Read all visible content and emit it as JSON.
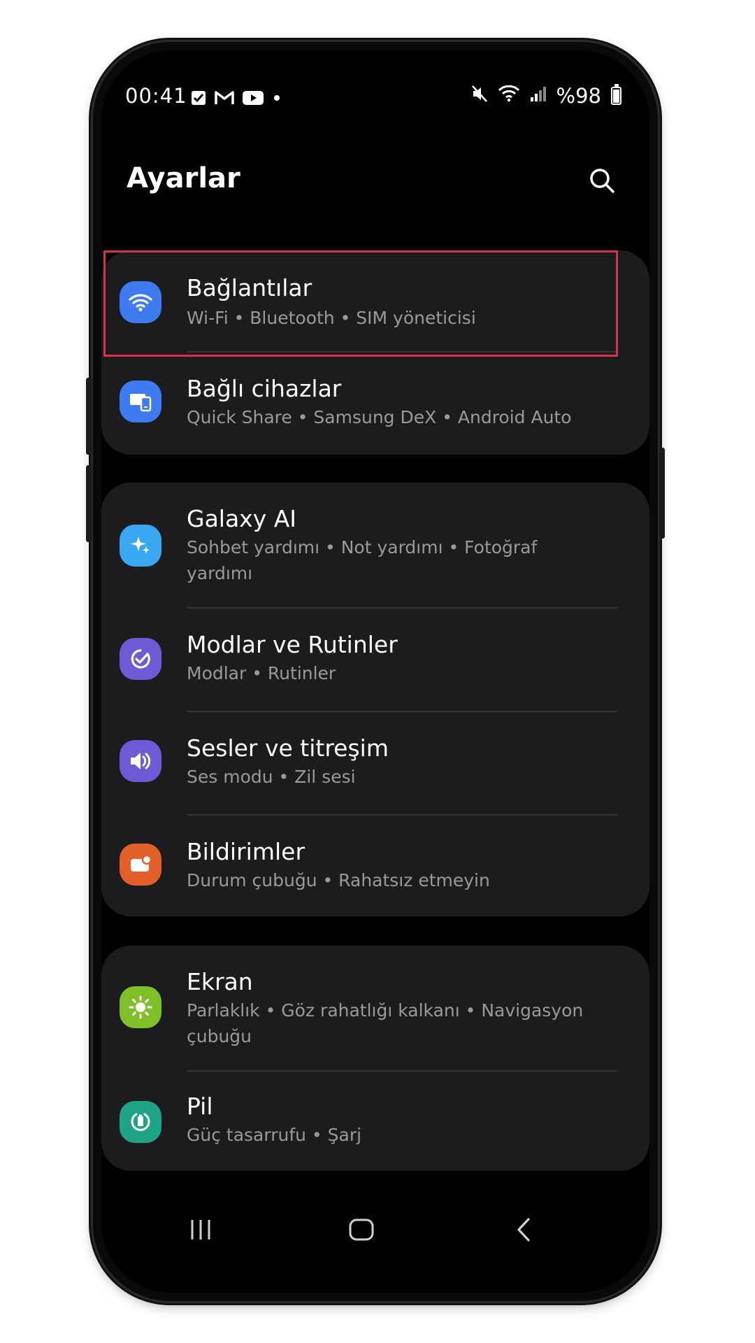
{
  "status_bar": {
    "time": "00:41",
    "battery": "%98",
    "left_icons": [
      "check-box-icon",
      "gmail-icon",
      "youtube-icon",
      "dot-icon"
    ],
    "right_icons": [
      "mute-vibrate-icon",
      "wifi-icon",
      "signal-icon",
      "battery-icon"
    ]
  },
  "header": {
    "title": "Ayarlar",
    "search_icon": "search-icon"
  },
  "groups": [
    {
      "items": [
        {
          "name": "Bağlantılar",
          "sub": "Wi-Fi  •  Bluetooth  •  SIM yöneticisi",
          "icon": "wifi-icon",
          "color": "#3e7bf0"
        },
        {
          "name": "Bağlı cihazlar",
          "sub": "Quick Share  •  Samsung DeX  •  Android Auto",
          "icon": "connected-devices-icon",
          "color": "#3e7bf0"
        }
      ]
    },
    {
      "items": [
        {
          "name": "Galaxy AI",
          "sub": "Sohbet yardımı  •  Not yardımı  •  Fotoğraf yardımı",
          "icon": "sparkle-icon",
          "color": "#3aa8f0"
        },
        {
          "name": "Modlar ve Rutinler",
          "sub": "Modlar  •  Rutinler",
          "icon": "check-circle-icon",
          "color": "#6d5bd6"
        },
        {
          "name": "Sesler ve titreşim",
          "sub": "Ses modu  •  Zil sesi",
          "icon": "speaker-icon",
          "color": "#6d5bd6"
        },
        {
          "name": "Bildirimler",
          "sub": "Durum çubuğu  •  Rahatsız etmeyin",
          "icon": "notification-icon",
          "color": "#e4602a"
        }
      ]
    },
    {
      "items": [
        {
          "name": "Ekran",
          "sub": "Parlaklık  •  Göz rahatlığı kalkanı  •  Navigasyon çubuğu",
          "icon": "sun-icon",
          "color": "#7fbf2a"
        },
        {
          "name": "Pil",
          "sub": "Güç tasarrufu  •  Şarj",
          "icon": "battery-settings-icon",
          "color": "#1fa386"
        }
      ]
    }
  ],
  "navbar": {
    "recents_icon": "recents-icon",
    "home_icon": "home-icon",
    "back_icon": "back-icon"
  }
}
